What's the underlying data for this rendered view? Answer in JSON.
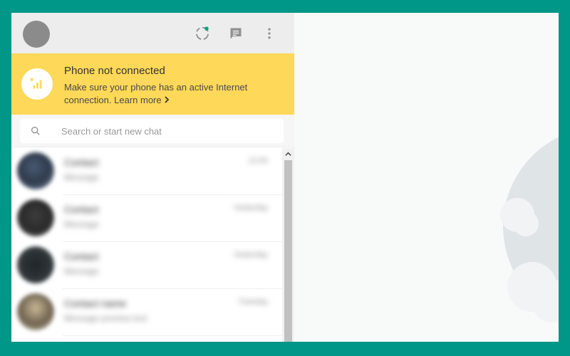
{
  "header": {
    "status_icon": "status-icon",
    "new_chat_icon": "chat-icon",
    "menu_icon": "menu-dots-icon"
  },
  "banner": {
    "icon": "no-signal-icon",
    "title": "Phone not connected",
    "message": "Make sure your phone has an active Internet connection.",
    "link_label": "Learn more",
    "link_icon": "chevron-right-icon",
    "background": "#fed859"
  },
  "search": {
    "icon": "search-icon",
    "placeholder": "Search or start new chat"
  },
  "chats": [
    {
      "name": "Contact",
      "time": "12:00",
      "preview": "Message"
    },
    {
      "name": "Contact",
      "time": "Yesterday",
      "preview": "Message"
    },
    {
      "name": "Contact",
      "time": "Yesterday",
      "preview": "Message"
    },
    {
      "name": "Contact name",
      "time": "Tuesday",
      "preview": "Message preview text"
    }
  ],
  "scrollbar": {
    "up_icon": "chevron-up-icon"
  },
  "colors": {
    "frame_background": "#009688",
    "header": "#ededed",
    "status_dot": "#00a884"
  }
}
